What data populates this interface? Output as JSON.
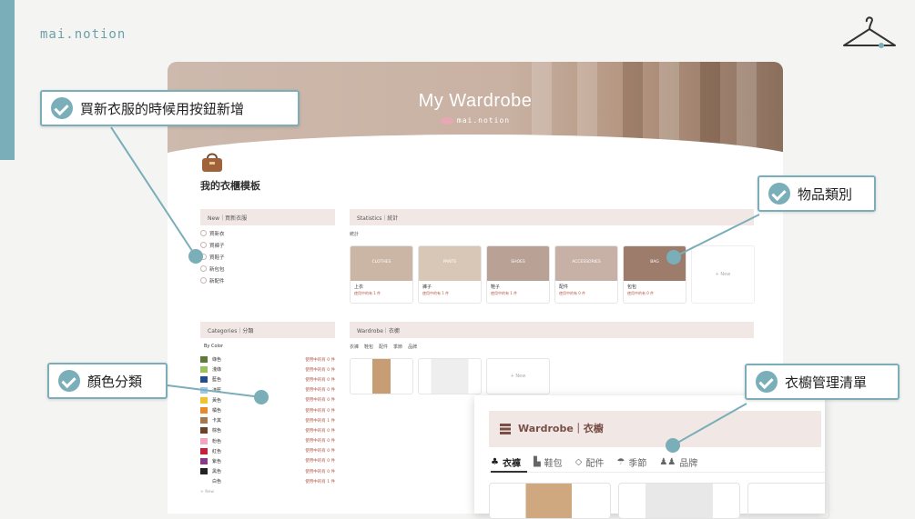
{
  "brand": "mai.notion",
  "page": {
    "cover_title": "My Wardrobe",
    "cover_sub": "mai.notion",
    "title": "我的衣櫃模板"
  },
  "new_panel": {
    "header": "New｜買新衣服",
    "items": [
      "買新衣",
      "買褲子",
      "買鞋子",
      "新包包",
      "新配件"
    ]
  },
  "stats_panel": {
    "header": "Statistics｜統計",
    "subhead": "統計",
    "cards": [
      {
        "overlay": "CLOTHES",
        "label": "上衣",
        "sub": "使用中的有 1 件",
        "color": "#cbb6a5"
      },
      {
        "overlay": "PANTS",
        "label": "褲子",
        "sub": "使用中的有 1 件",
        "color": "#d8c6b6"
      },
      {
        "overlay": "SHOES",
        "label": "鞋子",
        "sub": "使用中的有 1 件",
        "color": "#b9a196"
      },
      {
        "overlay": "ACCESSORIES",
        "label": "配件",
        "sub": "使用中的有 0 件",
        "color": "#c7b1a6"
      },
      {
        "overlay": "BAG",
        "label": "包包",
        "sub": "使用中的有 0 件",
        "color": "#9e7c6b"
      }
    ],
    "new_label": "+ New"
  },
  "categories_panel": {
    "header": "Categories｜分類",
    "group": "By Color",
    "colors": [
      {
        "name": "綠色",
        "num": "使用中的有 0 件",
        "color": "#5d7a3a"
      },
      {
        "name": "淺綠",
        "num": "使用中的有 0 件",
        "color": "#9bc25a"
      },
      {
        "name": "藍色",
        "num": "使用中的有 0 件",
        "color": "#234e8c"
      },
      {
        "name": "淺藍",
        "num": "使用中的有 0 件",
        "color": "#9cc8e8"
      },
      {
        "name": "黃色",
        "num": "使用中的有 0 件",
        "color": "#f2c12e"
      },
      {
        "name": "橘色",
        "num": "使用中的有 0 件",
        "color": "#e88a2a"
      },
      {
        "name": "卡其",
        "num": "使用中的有 1 件",
        "color": "#a4784c"
      },
      {
        "name": "棕色",
        "num": "使用中的有 0 件",
        "color": "#6b4428"
      },
      {
        "name": "粉色",
        "num": "使用中的有 0 件",
        "color": "#f1a6c2"
      },
      {
        "name": "紅色",
        "num": "使用中的有 0 件",
        "color": "#c4203a"
      },
      {
        "name": "紫色",
        "num": "使用中的有 0 件",
        "color": "#8a3a8a"
      },
      {
        "name": "黑色",
        "num": "使用中的有 0 件",
        "color": "#222222"
      },
      {
        "name": "白色",
        "num": "使用中的有 1 件",
        "color": "#ffffff"
      }
    ],
    "new_label": "+ New"
  },
  "wardrobe_panel": {
    "header": "Wardrobe｜衣櫥",
    "tabs": [
      "衣褲",
      "鞋包",
      "配件",
      "季節",
      "品牌"
    ],
    "new_label": "+ New"
  },
  "zoom": {
    "title": "Wardrobe｜衣櫥",
    "tabs": [
      "衣褲",
      "鞋包",
      "配件",
      "季節",
      "品牌"
    ]
  },
  "callouts": {
    "new_button": "買新衣服的時候用按鈕新增",
    "categories": "物品類別",
    "colors": "顏色分類",
    "wardrobe": "衣櫥管理清單"
  }
}
